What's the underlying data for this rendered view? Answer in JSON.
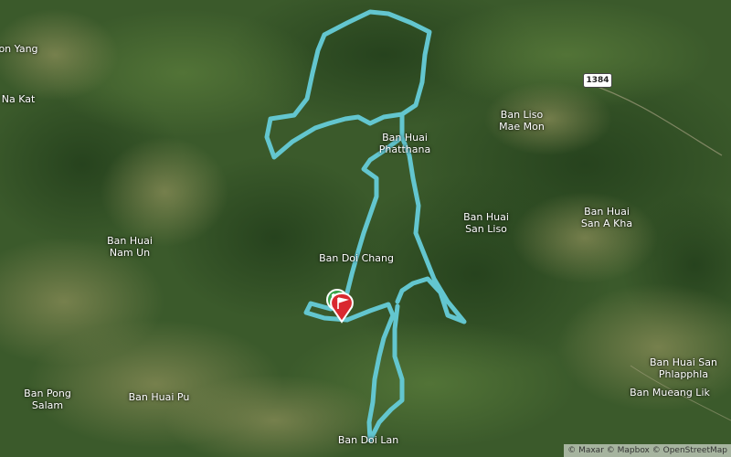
{
  "places": [
    {
      "id": "on-yang",
      "lines": [
        "on Yang"
      ]
    },
    {
      "id": "na-kat",
      "lines": [
        "Na Kat"
      ]
    },
    {
      "id": "ban-huai-nam-un",
      "lines": [
        "Ban Huai",
        "Nam Un"
      ]
    },
    {
      "id": "ban-pong-salam",
      "lines": [
        "Ban Pong",
        "Salam"
      ]
    },
    {
      "id": "ban-huai-pu",
      "lines": [
        "Ban Huai Pu"
      ]
    },
    {
      "id": "ban-huai-phatthana",
      "lines": [
        "Ban Huai",
        "Phatthana"
      ]
    },
    {
      "id": "ban-doi-chang",
      "lines": [
        "Ban Doi Chang"
      ]
    },
    {
      "id": "ban-doi-lan",
      "lines": [
        "Ban Doi Lan"
      ]
    },
    {
      "id": "ban-liso-mae-mon",
      "lines": [
        "Ban Liso",
        "Mae Mon"
      ]
    },
    {
      "id": "ban-huai-san-liso",
      "lines": [
        "Ban Huai",
        "San Liso"
      ]
    },
    {
      "id": "ban-huai-san-a-kha",
      "lines": [
        "Ban Huai",
        "San A Kha"
      ]
    },
    {
      "id": "ban-huai-san-phlapphla",
      "lines": [
        "Ban Huai San",
        "Phlapphla"
      ]
    },
    {
      "id": "ban-mueang-lik",
      "lines": [
        "Ban Mueang Lik"
      ]
    }
  ],
  "road_shield": "1384",
  "attribution": "© Maxar © Mapbox © OpenStreetMap",
  "colors": {
    "terrain_dark": "#2f4a24",
    "terrain_mid": "#4a6b33",
    "terrain_light": "#7a8a4e",
    "route": "#63c6cf",
    "start_marker": "#3aa34a",
    "end_marker": "#d9282f"
  },
  "markers": [
    {
      "id": "start",
      "icon": "start-flag-icon"
    },
    {
      "id": "end",
      "icon": "finish-flag-icon"
    }
  ]
}
